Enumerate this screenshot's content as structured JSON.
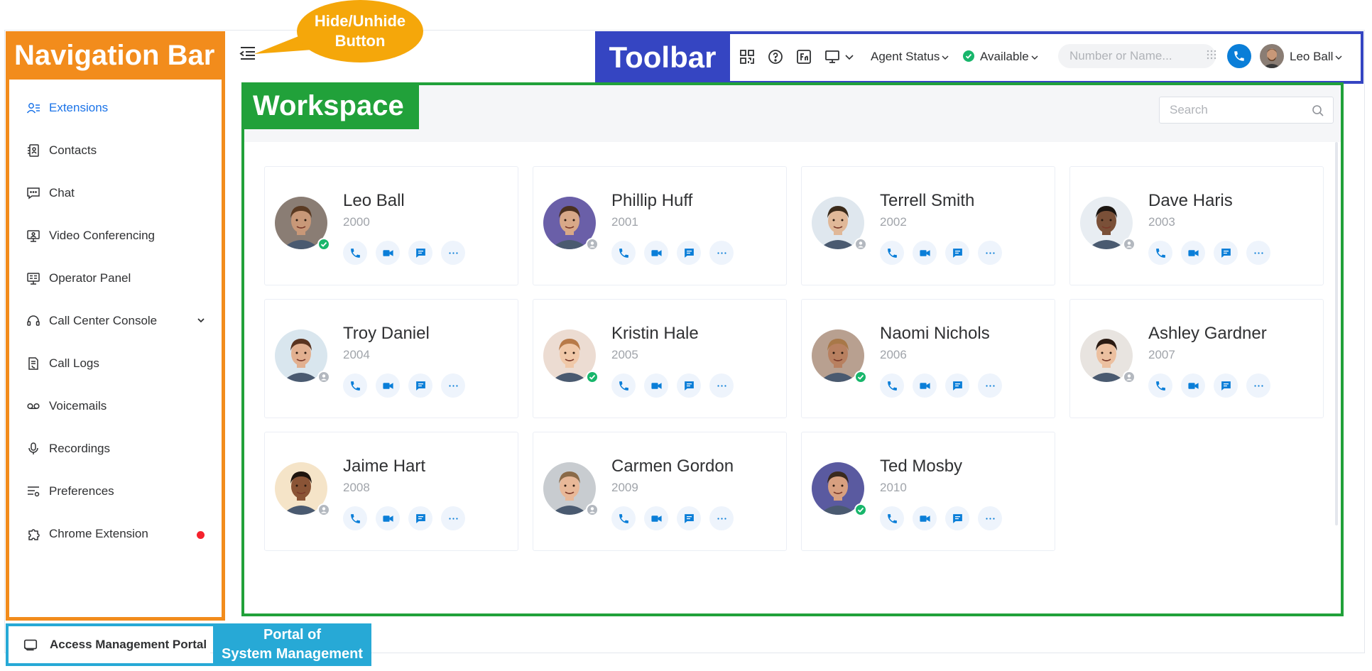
{
  "annotations": {
    "navigation_bar": "Navigation Bar",
    "hide_unhide_line1": "Hide/Unhide",
    "hide_unhide_line2": "Button",
    "toolbar": "Toolbar",
    "workspace": "Workspace",
    "portal_line1": "Portal of",
    "portal_line2": "System Management"
  },
  "sidebar": {
    "items": [
      {
        "label": "Extensions",
        "icon": "extensions-icon",
        "active": true
      },
      {
        "label": "Contacts",
        "icon": "contacts-icon"
      },
      {
        "label": "Chat",
        "icon": "chat-icon"
      },
      {
        "label": "Video Conferencing",
        "icon": "video-conferencing-icon"
      },
      {
        "label": "Operator Panel",
        "icon": "operator-panel-icon"
      },
      {
        "label": "Call Center Console",
        "icon": "headset-icon",
        "expandable": true
      },
      {
        "label": "Call Logs",
        "icon": "call-logs-icon"
      },
      {
        "label": "Voicemails",
        "icon": "voicemail-icon"
      },
      {
        "label": "Recordings",
        "icon": "microphone-icon"
      },
      {
        "label": "Preferences",
        "icon": "preferences-icon"
      },
      {
        "label": "Chrome Extension",
        "icon": "puzzle-icon",
        "badge": "red-dot"
      }
    ],
    "portal_button": "Access Management Portal"
  },
  "toolbar": {
    "icons": [
      "qr-code-icon",
      "help-icon",
      "fn-key-icon",
      "monitor-icon"
    ],
    "agent_status": "Agent Status",
    "presence": "Available",
    "dial_placeholder": "Number or Name...",
    "user_name": "Leo Ball"
  },
  "workspace": {
    "search_placeholder": "Search",
    "extensions": [
      {
        "name": "Leo Ball",
        "number": "2000",
        "online": true,
        "skin": "#c89878",
        "hair": "#5a3a22",
        "bg": "#8a7d74"
      },
      {
        "name": "Phillip Huff",
        "number": "2001",
        "online": false,
        "skin": "#d8a888",
        "hair": "#4a3020",
        "bg": "#6a5fa8"
      },
      {
        "name": "Terrell Smith",
        "number": "2002",
        "online": false,
        "skin": "#e0b898",
        "hair": "#3a2a1a",
        "bg": "#dfe7ee"
      },
      {
        "name": "Dave Haris",
        "number": "2003",
        "online": false,
        "skin": "#7a5038",
        "hair": "#1a1410",
        "bg": "#e8edf2"
      },
      {
        "name": "Troy Daniel",
        "number": "2004",
        "online": false,
        "skin": "#e2b090",
        "hair": "#5a3420",
        "bg": "#d9e6ee"
      },
      {
        "name": "Kristin Hale",
        "number": "2005",
        "online": true,
        "skin": "#f0c8a8",
        "hair": "#b87a48",
        "bg": "#ecdcd2"
      },
      {
        "name": "Naomi Nichols",
        "number": "2006",
        "online": true,
        "skin": "#b88060",
        "hair": "#a87848",
        "bg": "#b8a090"
      },
      {
        "name": "Ashley Gardner",
        "number": "2007",
        "online": false,
        "skin": "#ecc0a0",
        "hair": "#2a1a12",
        "bg": "#e8e4e0"
      },
      {
        "name": "Jaime Hart",
        "number": "2008",
        "online": false,
        "skin": "#8a5436",
        "hair": "#1e140e",
        "bg": "#f5e4c8"
      },
      {
        "name": "Carmen Gordon",
        "number": "2009",
        "online": false,
        "skin": "#e8b898",
        "hair": "#8a6a48",
        "bg": "#c8ccd0"
      },
      {
        "name": "Ted Mosby",
        "number": "2010",
        "online": true,
        "skin": "#d8a080",
        "hair": "#3a2a1e",
        "bg": "#5a5aa0"
      }
    ],
    "action_icons": [
      "phone-icon",
      "video-call-icon",
      "message-icon",
      "more-icon"
    ]
  },
  "colors": {
    "accent": "#0a7ed8",
    "nav_outline": "#f28c1c",
    "toolbar_outline": "#3545c2",
    "workspace_outline": "#21a13a",
    "portal_outline": "#27a9d6",
    "callout": "#f5a70a",
    "online": "#18b66b",
    "offline": "#b3b8bf"
  }
}
